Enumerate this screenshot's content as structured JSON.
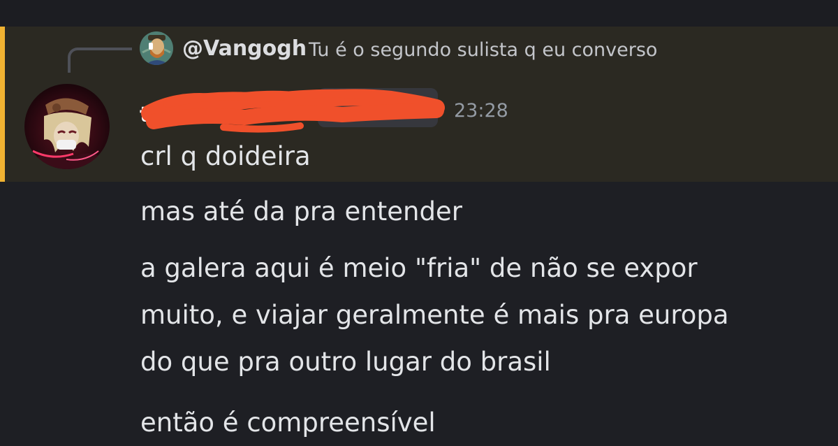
{
  "reply": {
    "author": "@Vangogh",
    "text": "Tu é o segundo sulista q eu converso"
  },
  "message": {
    "author_visible_fragment": "t",
    "timestamp": "23:28",
    "lines": [
      "crl q doideira",
      "mas até da pra entender",
      "a galera aqui é meio \"fria\" de não se expor",
      "muito, e viajar geralmente é mais pra europa",
      "do que pra outro lugar do brasil",
      "então é compreensível"
    ]
  },
  "colors": {
    "background": "#1e1f24",
    "mention_highlight": "#2b2922",
    "mention_bar": "#f0b232",
    "redaction": "#f0502b",
    "text": "#e3e5e8",
    "muted": "#949ba4"
  },
  "icons": {
    "reply_avatar": "vangogh-portrait-avatar",
    "author_avatar": "anime-character-avatar"
  }
}
